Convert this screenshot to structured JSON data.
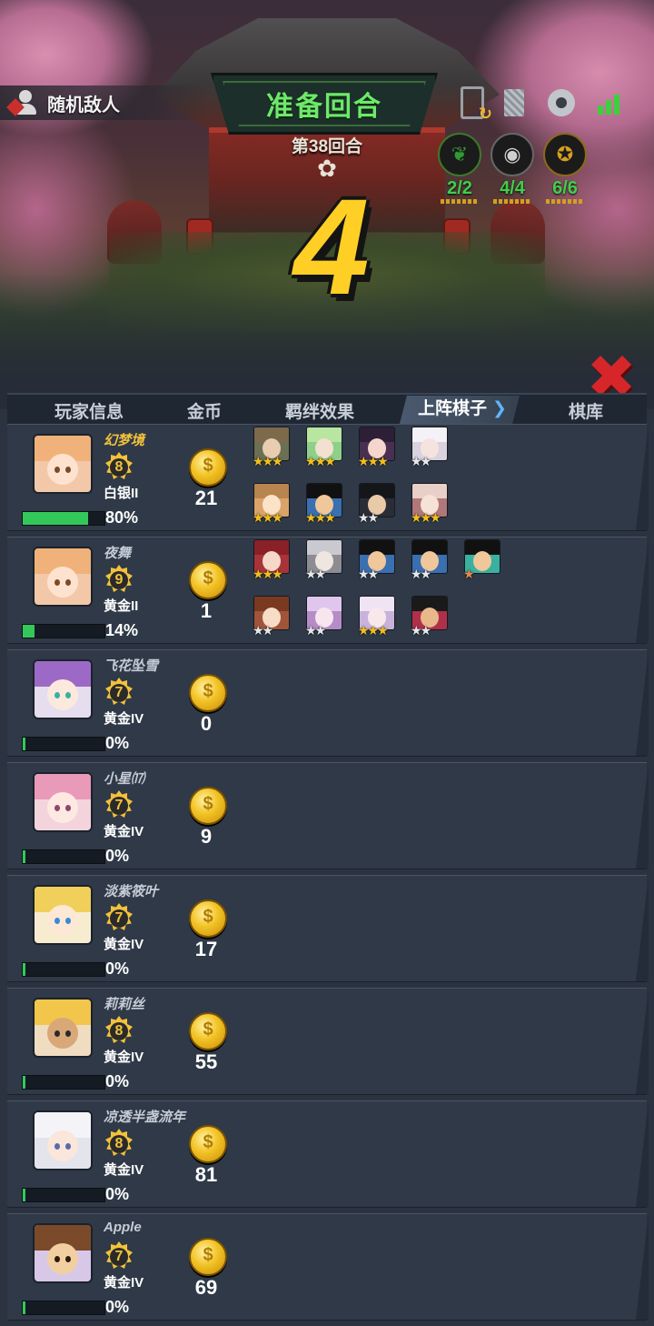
{
  "header": {
    "enemy_label": "随机敌人",
    "phase_title": "准备回合",
    "round_label": "第38回合",
    "countdown": "4",
    "traits": [
      {
        "icon": "leaf-icon",
        "count": "2/2",
        "color": "#3fcf4a"
      },
      {
        "icon": "eye-icon",
        "count": "4/4",
        "color": "#3fcf4a"
      },
      {
        "icon": "seal-icon",
        "count": "6/6",
        "color": "#3fcf4a"
      }
    ]
  },
  "tabs": {
    "player_info": "玩家信息",
    "gold": "金币",
    "synergy": "羁绊效果",
    "deployed": "上阵棋子",
    "bench": "棋库"
  },
  "players": [
    {
      "name": "幻梦境",
      "level": "8",
      "rank": "白银II",
      "hp": "80%",
      "hp_fraction": 0.8,
      "gold": "21"
    },
    {
      "name": "夜舞",
      "level": "9",
      "rank": "黄金II",
      "hp": "14%",
      "hp_fraction": 0.14,
      "gold": "1"
    },
    {
      "name": "飞花坠雪",
      "level": "7",
      "rank": "黄金IV",
      "hp": "0%",
      "hp_fraction": 0.0,
      "gold": "0"
    },
    {
      "name": "小星⒄",
      "level": "7",
      "rank": "黄金IV",
      "hp": "0%",
      "hp_fraction": 0.0,
      "gold": "9"
    },
    {
      "name": "淡紫筱叶",
      "level": "7",
      "rank": "黄金IV",
      "hp": "0%",
      "hp_fraction": 0.0,
      "gold": "17"
    },
    {
      "name": "莉莉丝",
      "level": "8",
      "rank": "黄金IV",
      "hp": "0%",
      "hp_fraction": 0.0,
      "gold": "55"
    },
    {
      "name": "凉透半盏流年",
      "level": "8",
      "rank": "黄金IV",
      "hp": "0%",
      "hp_fraction": 0.0,
      "gold": "81"
    },
    {
      "name": "Apple",
      "level": "7",
      "rank": "黄金IV",
      "hp": "0%",
      "hp_fraction": 0.0,
      "gold": "69"
    }
  ],
  "board_p1": [
    {
      "stars": "★★★",
      "tier": "gold"
    },
    {
      "stars": "★★★",
      "tier": "gold"
    },
    {
      "stars": "★★★",
      "tier": "gold"
    },
    {
      "stars": "★★",
      "tier": "silver"
    },
    {
      "stars": "★★★",
      "tier": "gold"
    },
    {
      "stars": "★★★",
      "tier": "gold"
    },
    {
      "stars": "★★",
      "tier": "silver"
    },
    {
      "stars": "★★★",
      "tier": "gold"
    }
  ],
  "board_p2": [
    {
      "stars": "★★★",
      "tier": "gold"
    },
    {
      "stars": "★★",
      "tier": "silver"
    },
    {
      "stars": "★★",
      "tier": "silver"
    },
    {
      "stars": "★★",
      "tier": "silver"
    },
    {
      "stars": "★",
      "tier": "bronze"
    },
    {
      "stars": "★★",
      "tier": "silver"
    },
    {
      "stars": "★★",
      "tier": "silver"
    },
    {
      "stars": "★★★",
      "tier": "gold"
    },
    {
      "stars": "★★",
      "tier": "silver"
    }
  ]
}
